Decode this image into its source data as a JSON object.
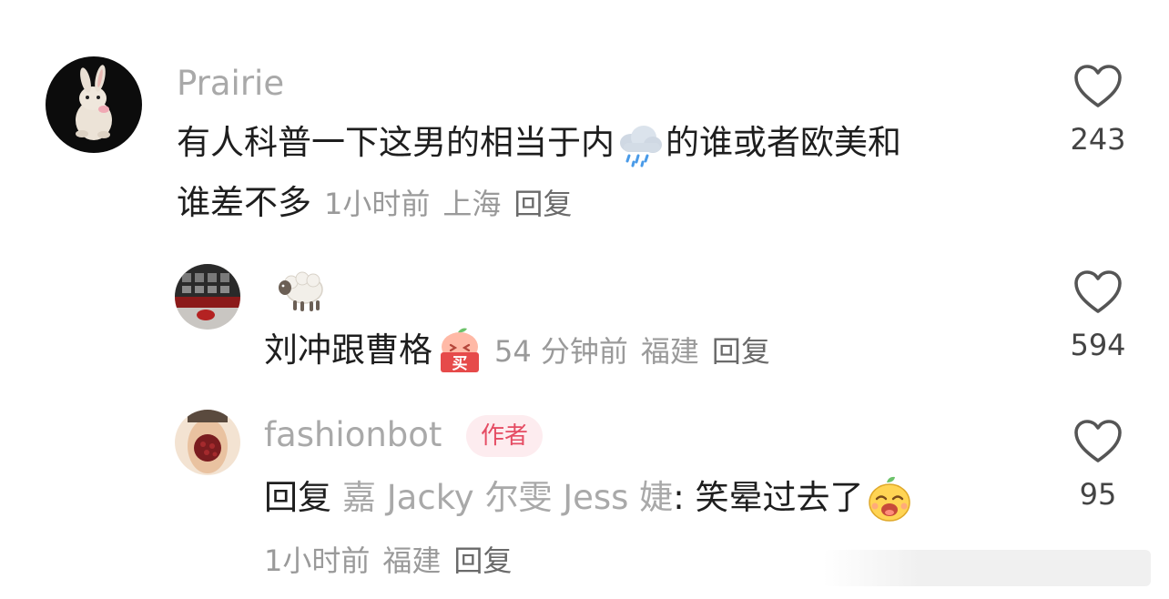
{
  "comments": [
    {
      "username": "Prairie",
      "avatar": "rabbit-avatar",
      "text_line1": "有人科普一下这男的相当于内",
      "emoji": "rain-cloud-emoji",
      "text_line1_after": "的谁或者欧美和",
      "text_line2": "谁差不多",
      "time": "1小时前",
      "location": "上海",
      "reply_label": "回复",
      "likes": "243"
    },
    {
      "username": "",
      "username_emoji": "sheep-emoji",
      "avatar": "grid-photo-avatar",
      "text": "刘冲跟曹格",
      "emoji": "buy-emoji",
      "emoji_text": "买",
      "time": "54 分钟前",
      "location": "福建",
      "reply_label": "回复",
      "likes": "594"
    },
    {
      "username": "fashionbot",
      "author_badge": "作者",
      "avatar": "face-avatar",
      "reply_prefix": "回复",
      "quoted_user": "嘉 Jacky 尔雯 Jess 婕",
      "text": ": 笑晕过去了",
      "emoji": "laughing-fruit-emoji",
      "time": "1小时前",
      "location": "福建",
      "reply_label": "回复",
      "likes": "95"
    }
  ],
  "colors": {
    "username": "#a9a9a9",
    "text": "#1e1e1e",
    "meta": "#9a9a9a",
    "badge_bg": "#fdecef",
    "badge_text": "#e54c63"
  }
}
